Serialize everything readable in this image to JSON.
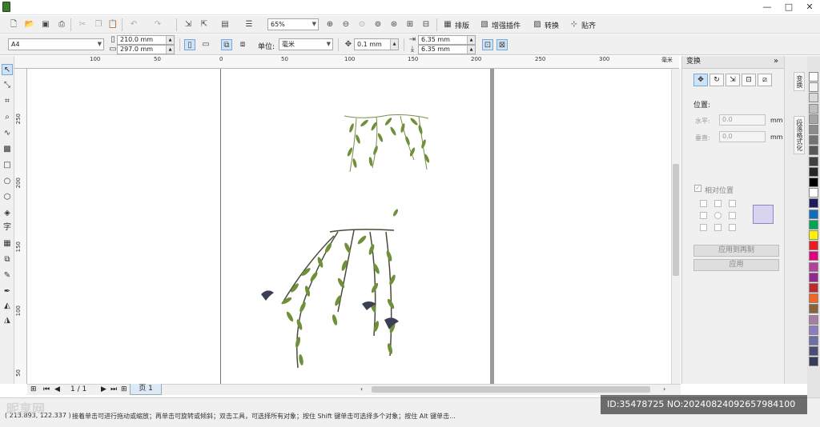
{
  "toolbar1": {
    "zoom_value": "65%",
    "layout_label": "排版",
    "plugins_label": "增强插件",
    "convert_label": "转换",
    "align_label": "贴齐"
  },
  "toolbar2": {
    "paper_size": "A4",
    "width_value": "210.0 mm",
    "height_value": "297.0 mm",
    "units_label": "单位:",
    "units_value": "毫米",
    "nudge_value": "0.1 mm",
    "dup_x_value": "6.35 mm",
    "dup_y_value": "6.35 mm"
  },
  "ruler_h": [
    "100",
    "50",
    "0",
    "50",
    "100",
    "150",
    "200",
    "250",
    "300"
  ],
  "ruler_h_unit": "毫米",
  "ruler_v": [
    "250",
    "200",
    "150",
    "100",
    "50"
  ],
  "toolbox": {
    "text_tool_label": "字"
  },
  "page_nav": {
    "page_count": "1 / 1",
    "page_tab": "页 1"
  },
  "statusbar": {
    "coords": "( 213.893, 122.337 )",
    "hint": "接着单击可进行拖动或缩放；再单击可旋转或倾斜；双击工具，可选择所有对象；按住 Shift 键单击可选择多个对象；按住 Alt 键单击..."
  },
  "docker": {
    "title": "变换",
    "position_header": "位置:",
    "h_label": "水平:",
    "v_label": "垂直:",
    "h_value": "0.0",
    "v_value": "0.0",
    "unit": "mm",
    "relative_label": "相对位置",
    "apply_copy_label": "应用到再制",
    "apply_label": "应用"
  },
  "side_tabs": {
    "transform": "变换",
    "paragraph": "段落格式化"
  },
  "palette": [
    "#ffffff",
    "#f2f2f2",
    "#d9d9d9",
    "#bfbfbf",
    "#a6a6a6",
    "#8c8c8c",
    "#737373",
    "#595959",
    "#404040",
    "#262626",
    "#000000",
    "#ffffff",
    "#1f1a5e",
    "#0d6ebd",
    "#00a651",
    "#fff200",
    "#ed1c24",
    "#e4007f",
    "#b5409d",
    "#92278f",
    "#c1272d",
    "#f26522",
    "#8c6239",
    "#a87ca6",
    "#8e7cc3",
    "#6d6fa8",
    "#4a4d7a",
    "#353a5e"
  ],
  "watermark": {
    "site": "昵享网",
    "id_text": "ID:35478725 NO:20240824092657984100"
  }
}
